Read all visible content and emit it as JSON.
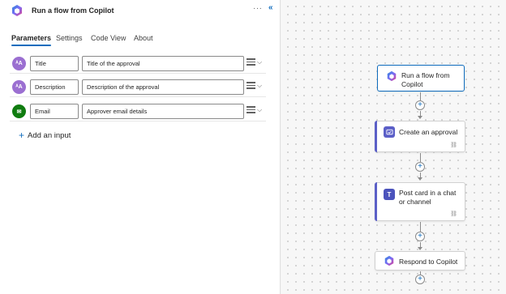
{
  "panel": {
    "title": "Run a flow from Copilot",
    "more_label": "···",
    "collapse_label": "«",
    "tabs": [
      {
        "label": "Parameters",
        "active": true
      },
      {
        "label": "Settings",
        "active": false
      },
      {
        "label": "Code View",
        "active": false
      },
      {
        "label": "About",
        "active": false
      }
    ],
    "parameters": [
      {
        "icon": "text-icon",
        "icon_glyph": "ᴬA",
        "color": "#9b6fd1",
        "name": "Title",
        "description": "Title of the approval"
      },
      {
        "icon": "text-icon",
        "icon_glyph": "ᴬA",
        "color": "#9b6fd1",
        "name": "Description",
        "description": "Description of the approval"
      },
      {
        "icon": "email-icon",
        "icon_glyph": "✉",
        "color": "#107c10",
        "name": "Email",
        "description": "Approver email details"
      }
    ],
    "add_input_label": "Add an input"
  },
  "flow": {
    "nodes": [
      {
        "label": "Run a flow from Copilot",
        "icon": "copilot-icon",
        "selected": true
      },
      {
        "label": "Create an approval",
        "icon": "approvals-icon",
        "accent": "#5b5fc7"
      },
      {
        "label": "Post card in a chat or channel",
        "icon": "teams-icon",
        "accent": "#5b5fc7"
      },
      {
        "label": "Respond to Copilot",
        "icon": "copilot-icon"
      }
    ],
    "add_step_symbol": "+",
    "link_symbol": "⛓"
  }
}
